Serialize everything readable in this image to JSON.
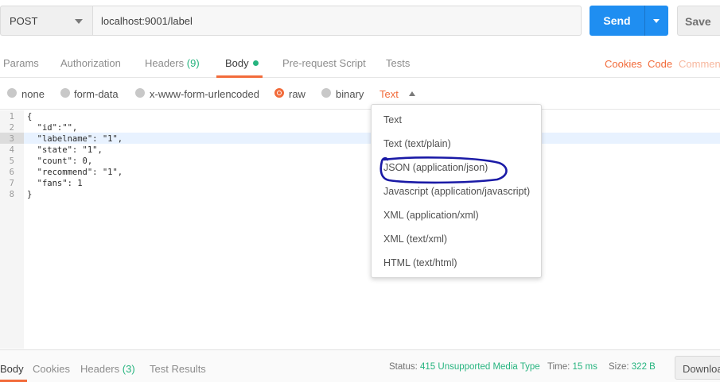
{
  "request": {
    "method": "POST",
    "url": "localhost:9001/label",
    "send_label": "Send",
    "save_label": "Save"
  },
  "tabs": [
    {
      "label": "Params"
    },
    {
      "label": "Authorization"
    },
    {
      "label": "Headers",
      "count": "(9)"
    },
    {
      "label": "Body"
    },
    {
      "label": "Pre-request Script"
    },
    {
      "label": "Tests"
    }
  ],
  "right_links": {
    "cookies": "Cookies",
    "code": "Code",
    "comments": "Commen"
  },
  "body_types": [
    {
      "label": "none",
      "selected": false
    },
    {
      "label": "form-data",
      "selected": false
    },
    {
      "label": "x-www-form-urlencoded",
      "selected": false
    },
    {
      "label": "raw",
      "selected": true
    },
    {
      "label": "binary",
      "selected": false
    }
  ],
  "raw_type": "Text",
  "editor": {
    "line_numbers": [
      "1",
      "2",
      "3",
      "4",
      "5",
      "6",
      "7",
      "8"
    ],
    "lines": [
      "{",
      "  \"id\":\"\",",
      "  \"labelname\": \"1\",",
      "  \"state\": \"1\",",
      "  \"count\": 0,",
      "  \"recommend\": \"1\",",
      "  \"fans\": 1",
      "}"
    ],
    "active_line": 3
  },
  "dropdown": {
    "items": [
      "Text",
      "Text (text/plain)",
      "JSON (application/json)",
      "Javascript (application/javascript)",
      "XML (application/xml)",
      "XML (text/xml)",
      "HTML (text/html)"
    ],
    "annotated_item": "JSON (application/json)",
    "annotation_color": "#1a1aa6"
  },
  "response": {
    "tabs": [
      {
        "label": "Body"
      },
      {
        "label": "Cookies"
      },
      {
        "label": "Headers",
        "count": "(3)"
      },
      {
        "label": "Test Results"
      }
    ],
    "status_label": "Status:",
    "status_value": "415 Unsupported Media Type",
    "time_label": "Time:",
    "time_value": "15 ms",
    "size_label": "Size:",
    "size_value": "322 B",
    "download_label": "Downloa"
  },
  "colors": {
    "accent": "#f26b3a",
    "send": "#1f8ef1",
    "success": "#26b47f"
  }
}
